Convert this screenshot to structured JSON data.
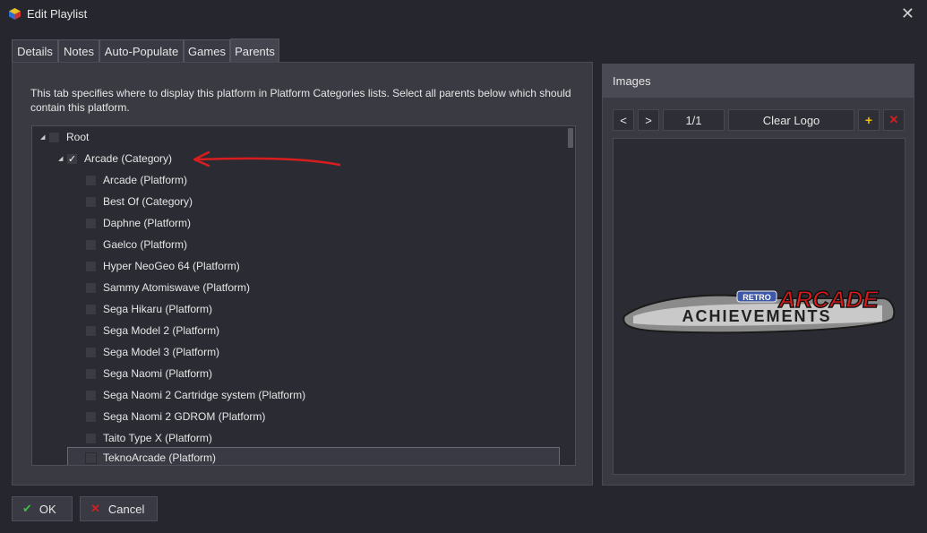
{
  "window": {
    "title": "Edit Playlist"
  },
  "tabs": [
    {
      "label": "Details"
    },
    {
      "label": "Notes"
    },
    {
      "label": "Auto-Populate"
    },
    {
      "label": "Games"
    },
    {
      "label": "Parents",
      "active": true
    }
  ],
  "parents": {
    "description": "This tab specifies where to display this platform in Platform Categories lists. Select all parents below which should contain this platform.",
    "tree": [
      {
        "label": "Root",
        "checked": false,
        "expanded": true
      },
      {
        "label": "Arcade (Category)",
        "checked": true,
        "expanded": true
      },
      {
        "label": "Arcade (Platform)",
        "checked": false
      },
      {
        "label": "Best Of (Category)",
        "checked": false
      },
      {
        "label": "Daphne (Platform)",
        "checked": false
      },
      {
        "label": "Gaelco (Platform)",
        "checked": false
      },
      {
        "label": "Hyper NeoGeo 64 (Platform)",
        "checked": false
      },
      {
        "label": "Sammy Atomiswave (Platform)",
        "checked": false
      },
      {
        "label": "Sega Hikaru (Platform)",
        "checked": false
      },
      {
        "label": "Sega Model 2 (Platform)",
        "checked": false
      },
      {
        "label": "Sega Model 3 (Platform)",
        "checked": false
      },
      {
        "label": "Sega Naomi (Platform)",
        "checked": false
      },
      {
        "label": "Sega Naomi 2 Cartridge system (Platform)",
        "checked": false
      },
      {
        "label": "Sega Naomi 2 GDROM (Platform)",
        "checked": false
      },
      {
        "label": "Taito Type X (Platform)",
        "checked": false
      },
      {
        "label": "TeknoArcade (Platform)",
        "checked": false,
        "selected": true
      }
    ]
  },
  "images": {
    "header": "Images",
    "prev_label": "<",
    "next_label": ">",
    "page_counter": "1/1",
    "clear_label": "Clear Logo",
    "logo_text_small": "RETRO",
    "logo_text_main": "ARCADE",
    "logo_text_sub": "ACHIEVEMENTS"
  },
  "footer": {
    "ok_label": "OK",
    "cancel_label": "Cancel"
  },
  "colors": {
    "accent_red": "#d61e1e",
    "ok_green": "#3fbf3f",
    "add_yellow": "#f0c000"
  }
}
